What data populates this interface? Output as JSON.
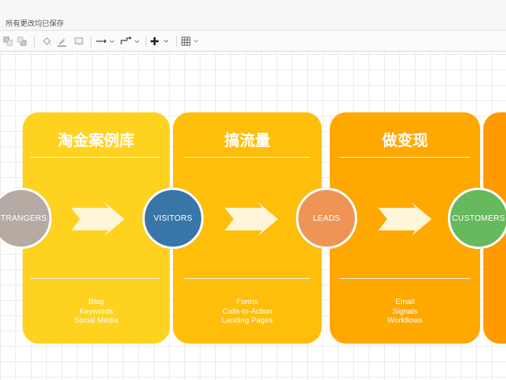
{
  "status_bar": {
    "text": "所有更改均已保存"
  },
  "toolbar": {
    "icons": [
      "to-front-icon",
      "to-back-icon",
      "fill-color-icon",
      "line-color-icon",
      "shadow-icon",
      "connection-icon",
      "waypoints-icon",
      "insert-icon",
      "table-icon"
    ]
  },
  "diagram": {
    "panels": [
      {
        "title": "淘金案例库",
        "color": "#FFD21F",
        "items": [
          "Blog",
          "Keywords",
          "Social Media"
        ]
      },
      {
        "title": "搞流量",
        "color": "#FFBE0A",
        "items": [
          "Forms",
          "Calls-to-Action",
          "Landing Pages"
        ]
      },
      {
        "title": "做变现",
        "color": "#FFA800",
        "items": [
          "Email",
          "Signals",
          "Workflows"
        ]
      },
      {
        "title": "",
        "color": "#FF9A00",
        "items": []
      }
    ],
    "stages": [
      {
        "label": "STRANGERS",
        "color": "#B5ABA3"
      },
      {
        "label": "VISITORS",
        "color": "#3776A6"
      },
      {
        "label": "LEADS",
        "color": "#EE9556"
      },
      {
        "label": "CUSTOMERS",
        "color": "#66B95C"
      }
    ],
    "arrow_color": "#FFF6D9"
  }
}
